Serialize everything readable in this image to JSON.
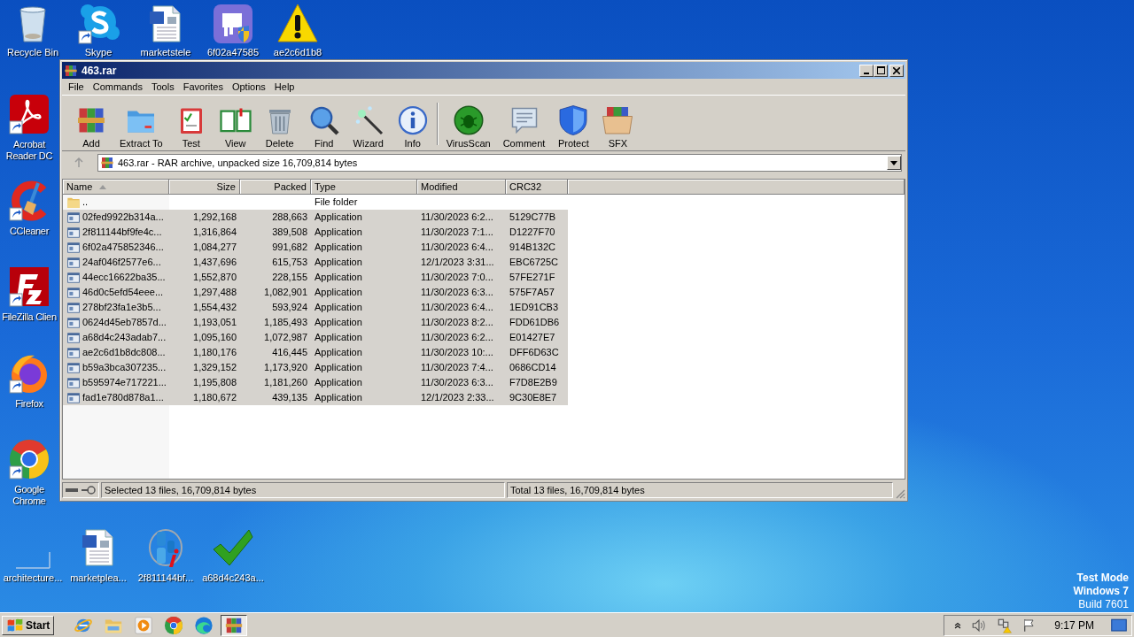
{
  "desktop": {
    "icons_top": [
      {
        "label": "Recycle Bin"
      },
      {
        "label": "Skype"
      },
      {
        "label": "marketstele"
      },
      {
        "label": "6f02a47585"
      },
      {
        "label": "ae2c6d1b8"
      }
    ],
    "icons_left": [
      {
        "label": "Acrobat Reader DC"
      },
      {
        "label": "CCleaner"
      },
      {
        "label": "FileZilla Clien"
      },
      {
        "label": "Firefox"
      },
      {
        "label": "Google Chrome"
      }
    ],
    "icons_bottom": [
      {
        "label": "architecture..."
      },
      {
        "label": "marketplea..."
      },
      {
        "label": "2f811144bf..."
      },
      {
        "label": "a68d4c243a..."
      }
    ],
    "os_notice": [
      "Test Mode",
      "Windows 7",
      "Build 7601"
    ]
  },
  "window": {
    "title": "463.rar",
    "menu": [
      "File",
      "Commands",
      "Tools",
      "Favorites",
      "Options",
      "Help"
    ],
    "toolbar": [
      "Add",
      "Extract To",
      "Test",
      "View",
      "Delete",
      "Find",
      "Wizard",
      "Info",
      "VirusScan",
      "Comment",
      "Protect",
      "SFX"
    ],
    "address": "463.rar - RAR archive, unpacked size 16,709,814 bytes",
    "columns": [
      {
        "label": "Name",
        "sorted": true
      },
      {
        "label": "Size",
        "sorted": false
      },
      {
        "label": "Packed",
        "sorted": false
      },
      {
        "label": "Type",
        "sorted": false
      },
      {
        "label": "Modified",
        "sorted": false
      },
      {
        "label": "CRC32",
        "sorted": false
      }
    ],
    "rows": [
      {
        "kind": "folder",
        "name": "..",
        "type": "File folder",
        "selected": false
      },
      {
        "kind": "file",
        "name": "02fed9922b314a...",
        "size": "1,292,168",
        "packed": "288,663",
        "type": "Application",
        "modified": "11/30/2023 6:2...",
        "crc": "5129C77B",
        "selected": true
      },
      {
        "kind": "file",
        "name": "2f811144bf9fe4c...",
        "size": "1,316,864",
        "packed": "389,508",
        "type": "Application",
        "modified": "11/30/2023 7:1...",
        "crc": "D1227F70",
        "selected": true
      },
      {
        "kind": "file",
        "name": "6f02a475852346...",
        "size": "1,084,277",
        "packed": "991,682",
        "type": "Application",
        "modified": "11/30/2023 6:4...",
        "crc": "914B132C",
        "selected": true
      },
      {
        "kind": "file",
        "name": "24af046f2577e6...",
        "size": "1,437,696",
        "packed": "615,753",
        "type": "Application",
        "modified": "12/1/2023 3:31...",
        "crc": "EBC6725C",
        "selected": true
      },
      {
        "kind": "file",
        "name": "44ecc16622ba35...",
        "size": "1,552,870",
        "packed": "228,155",
        "type": "Application",
        "modified": "11/30/2023 7:0...",
        "crc": "57FE271F",
        "selected": true
      },
      {
        "kind": "file",
        "name": "46d0c5efd54eee...",
        "size": "1,297,488",
        "packed": "1,082,901",
        "type": "Application",
        "modified": "11/30/2023 6:3...",
        "crc": "575F7A57",
        "selected": true
      },
      {
        "kind": "file",
        "name": "278bf23fa1e3b5...",
        "size": "1,554,432",
        "packed": "593,924",
        "type": "Application",
        "modified": "11/30/2023 6:4...",
        "crc": "1ED91CB3",
        "selected": true
      },
      {
        "kind": "file",
        "name": "0624d45eb7857d...",
        "size": "1,193,051",
        "packed": "1,185,493",
        "type": "Application",
        "modified": "11/30/2023 8:2...",
        "crc": "FDD61DB6",
        "selected": true
      },
      {
        "kind": "file",
        "name": "a68d4c243adab7...",
        "size": "1,095,160",
        "packed": "1,072,987",
        "type": "Application",
        "modified": "11/30/2023 6:2...",
        "crc": "E01427E7",
        "selected": true
      },
      {
        "kind": "file",
        "name": "ae2c6d1b8dc808...",
        "size": "1,180,176",
        "packed": "416,445",
        "type": "Application",
        "modified": "11/30/2023 10:...",
        "crc": "DFF6D63C",
        "selected": true
      },
      {
        "kind": "file",
        "name": "b59a3bca307235...",
        "size": "1,329,152",
        "packed": "1,173,920",
        "type": "Application",
        "modified": "11/30/2023 7:4...",
        "crc": "0686CD14",
        "selected": true
      },
      {
        "kind": "file",
        "name": "b595974e717221...",
        "size": "1,195,808",
        "packed": "1,181,260",
        "type": "Application",
        "modified": "11/30/2023 6:3...",
        "crc": "F7D8E2B9",
        "selected": true
      },
      {
        "kind": "file",
        "name": "fad1e780d878a1...",
        "size": "1,180,672",
        "packed": "439,135",
        "type": "Application",
        "modified": "12/1/2023 2:33...",
        "crc": "9C30E8E7",
        "selected": true
      }
    ],
    "status_bar": {
      "selected": "Selected 13 files, 16,709,814 bytes",
      "total": "Total 13 files, 16,709,814 bytes"
    }
  },
  "taskbar": {
    "start": "Start",
    "apps": [
      {
        "selected": false
      },
      {
        "selected": false
      },
      {
        "selected": false
      },
      {
        "selected": false
      },
      {
        "selected": false
      },
      {
        "selected": true
      }
    ],
    "clock": "9:17 PM"
  }
}
